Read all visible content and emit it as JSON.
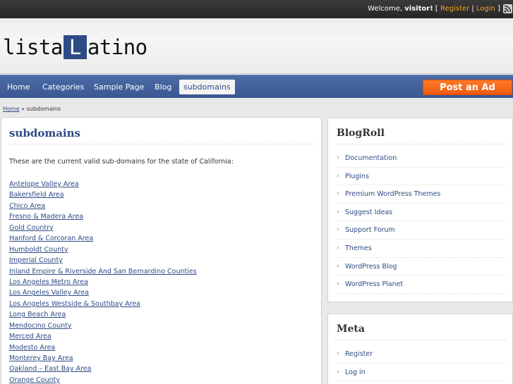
{
  "topbar": {
    "welcome_prefix": "Welcome, ",
    "user": "visitor!",
    "open_bracket": " [ ",
    "register": "Register",
    "separator": " | ",
    "login": "Login",
    "close_bracket": " ]"
  },
  "logo": {
    "part1": "lista",
    "boxed": "L",
    "part2": "atino"
  },
  "nav": {
    "items": [
      "Home",
      "Categories",
      "Sample Page",
      "Blog",
      "subdomains"
    ],
    "post_ad": "Post an Ad"
  },
  "breadcrumb": {
    "home": "Home",
    "sep": " » ",
    "current": "subdomains"
  },
  "main": {
    "title": "subdomains",
    "intro": "These are the current valid sub-domains for the state of California:",
    "links": [
      "Antelope Valley Area",
      "Bakersfield Area",
      "Chico Area",
      "Fresno & Madera Area",
      "Gold Country",
      "Hanford & Corcoran Area",
      "Humboldt County",
      "Imperial County",
      "Inland Empire & Riverside And San Bernardino Counties",
      "Los Angeles Metro Area",
      "Los Angeles Valley Area",
      "Los Angeles Westside & Southbay Area",
      "Long Beach Area",
      "Mendocino County",
      "Merced Area",
      "Modesto Area",
      "Monterey Bay Area",
      "Oakland – East Bay Area",
      "Orange County"
    ]
  },
  "blogroll": {
    "title": "BlogRoll",
    "items": [
      "Documentation",
      "Plugins",
      "Premium WordPress Themes",
      "Suggest Ideas",
      "Support Forum",
      "Themes",
      "WordPress Blog",
      "WordPress Planet"
    ]
  },
  "meta": {
    "title": "Meta",
    "items": [
      "Register",
      "Log in"
    ]
  },
  "icons": {
    "rss": "rss-icon",
    "chevron": "›"
  },
  "colors": {
    "brand": "#2d4b85",
    "accent": "#f05a0e",
    "link_top": "#f7a21b"
  }
}
